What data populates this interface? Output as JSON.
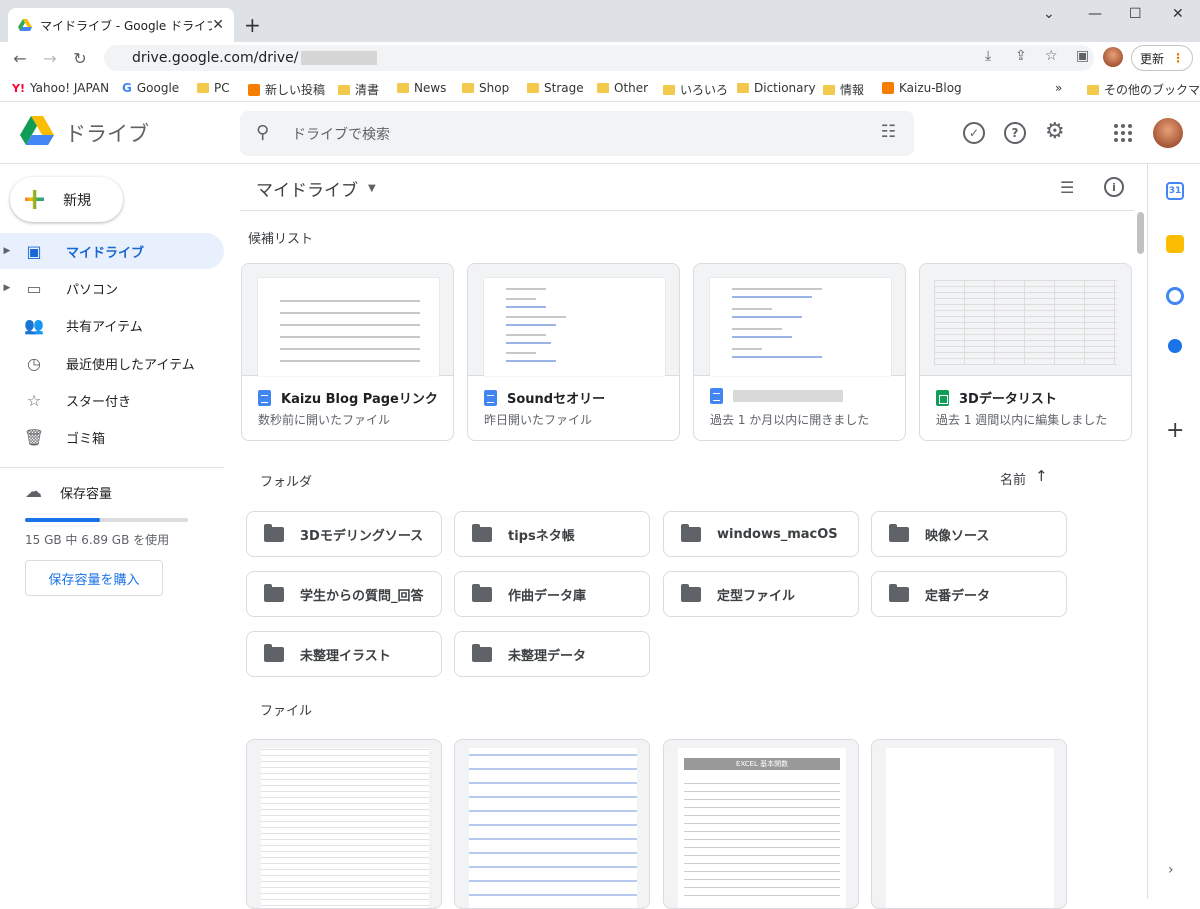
{
  "browser": {
    "tab_title": "マイドライブ - Google ドライブ",
    "url": "drive.google.com/drive/",
    "update_label": "更新",
    "bookmarks": [
      {
        "label": "Yahoo! JAPAN",
        "icon": "yahoo-icon"
      },
      {
        "label": "Google",
        "icon": "google-icon"
      },
      {
        "label": "PC",
        "icon": "folder-icon"
      },
      {
        "label": "新しい投稿",
        "icon": "blogger-icon"
      },
      {
        "label": "清書",
        "icon": "folder-icon"
      },
      {
        "label": "News",
        "icon": "folder-icon"
      },
      {
        "label": "Shop",
        "icon": "folder-icon"
      },
      {
        "label": "Strage",
        "icon": "folder-icon"
      },
      {
        "label": "Other",
        "icon": "folder-icon"
      },
      {
        "label": "いろいろ",
        "icon": "folder-icon"
      },
      {
        "label": "Dictionary",
        "icon": "folder-icon"
      },
      {
        "label": "情報",
        "icon": "folder-icon"
      },
      {
        "label": "Kaizu-Blog",
        "icon": "blogger-icon"
      }
    ],
    "other_bookmarks": "その他のブックマーク",
    "overflow": "»"
  },
  "header": {
    "app_name": "ドライブ",
    "search_placeholder": "ドライブで検索"
  },
  "sidebar": {
    "new_label": "新規",
    "items": [
      {
        "label": "マイドライブ",
        "icon": "my-drive-icon",
        "active": true
      },
      {
        "label": "パソコン",
        "icon": "computer-icon"
      },
      {
        "label": "共有アイテム",
        "icon": "shared-icon"
      },
      {
        "label": "最近使用したアイテム",
        "icon": "clock-icon"
      },
      {
        "label": "スター付き",
        "icon": "star-icon"
      },
      {
        "label": "ゴミ箱",
        "icon": "trash-icon"
      }
    ],
    "storage_label": "保存容量",
    "storage_text": "15 GB 中 6.89 GB を使用",
    "storage_used_fraction": 0.459,
    "buy_label": "保存容量を購入"
  },
  "main": {
    "title": "マイドライブ",
    "suggested_label": "候補リスト",
    "suggested": [
      {
        "name": "Kaizu Blog Pageリンク",
        "sub": "数秒前に開いたファイル",
        "type": "doc"
      },
      {
        "name": "Soundセオリー",
        "sub": "昨日開いたファイル",
        "type": "doc"
      },
      {
        "name": "",
        "sub": "過去 1 か月以内に開きました",
        "type": "doc"
      },
      {
        "name": "3Dデータリスト",
        "sub": "過去 1 週間以内に編集しました",
        "type": "sheet"
      }
    ],
    "folders_label": "フォルダ",
    "sort_label": "名前",
    "folders": [
      "3Dモデリングソース",
      "tipsネタ帳",
      "windows_macOS",
      "映像ソース",
      "学生からの質問_回答",
      "作曲データ庫",
      "定型ファイル",
      "定番データ",
      "未整理イラスト",
      "未整理データ"
    ],
    "files_label": "ファイル",
    "file_thumb_title": "EXCEL 基本関数"
  },
  "colors": {
    "accent": "#1a73e8",
    "active_bg": "#e8f0fe"
  }
}
